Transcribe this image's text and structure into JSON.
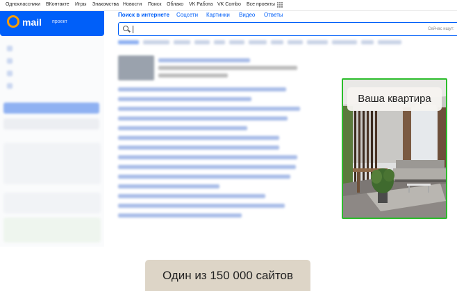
{
  "portal_bar": {
    "links": [
      "Одноклассники",
      "ВКонтакте",
      "Игры",
      "Знакомства",
      "Новости",
      "Поиск",
      "Облако",
      "VK Работа",
      "VK Combo",
      "Все проекты"
    ]
  },
  "brand": {
    "name": "mail",
    "project": "проект",
    "accent": "#005ff9",
    "logo_color": "#ff9e00"
  },
  "search": {
    "tabs": [
      "Поиск в интернете",
      "Соцсети",
      "Картинки",
      "Видео",
      "Ответы"
    ],
    "value": "",
    "hint": "Сейчас ищут:"
  },
  "promo": {
    "label": "Ваша квартира",
    "border_color": "#2bbd2b"
  },
  "tagline": {
    "text": "Один из 150 000 сайтов"
  }
}
